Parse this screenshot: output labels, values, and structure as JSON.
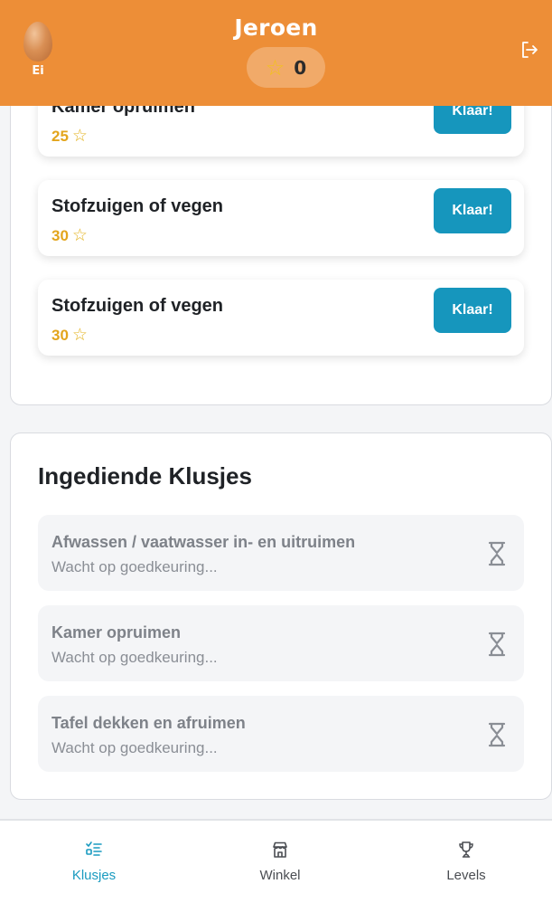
{
  "header": {
    "avatar_label": "Ei",
    "user_name": "Jeroen",
    "points": "0",
    "star_icon": "star-outline",
    "logout_icon": "logout-icon"
  },
  "chores": [
    {
      "title": "Kamer opruimen",
      "points": "25",
      "button": "Klaar!"
    },
    {
      "title": "Stofzuigen of vegen",
      "points": "30",
      "button": "Klaar!"
    },
    {
      "title": "Stofzuigen of vegen",
      "points": "30",
      "button": "Klaar!"
    }
  ],
  "submitted": {
    "title": "Ingediende Klusjes",
    "items": [
      {
        "title": "Afwassen / vaatwasser in- en uitruimen",
        "status": "Wacht op goedkeuring..."
      },
      {
        "title": "Kamer opruimen",
        "status": "Wacht op goedkeuring..."
      },
      {
        "title": "Tafel dekken en afruimen",
        "status": "Wacht op goedkeuring..."
      }
    ]
  },
  "nav": [
    {
      "label": "Klusjes",
      "icon": "list-check-icon",
      "active": true
    },
    {
      "label": "Winkel",
      "icon": "store-icon",
      "active": false
    },
    {
      "label": "Levels",
      "icon": "trophy-icon",
      "active": false
    }
  ],
  "colors": {
    "header": "#ed8e37",
    "accent": "#1696bd",
    "points": "#e3a51c"
  }
}
